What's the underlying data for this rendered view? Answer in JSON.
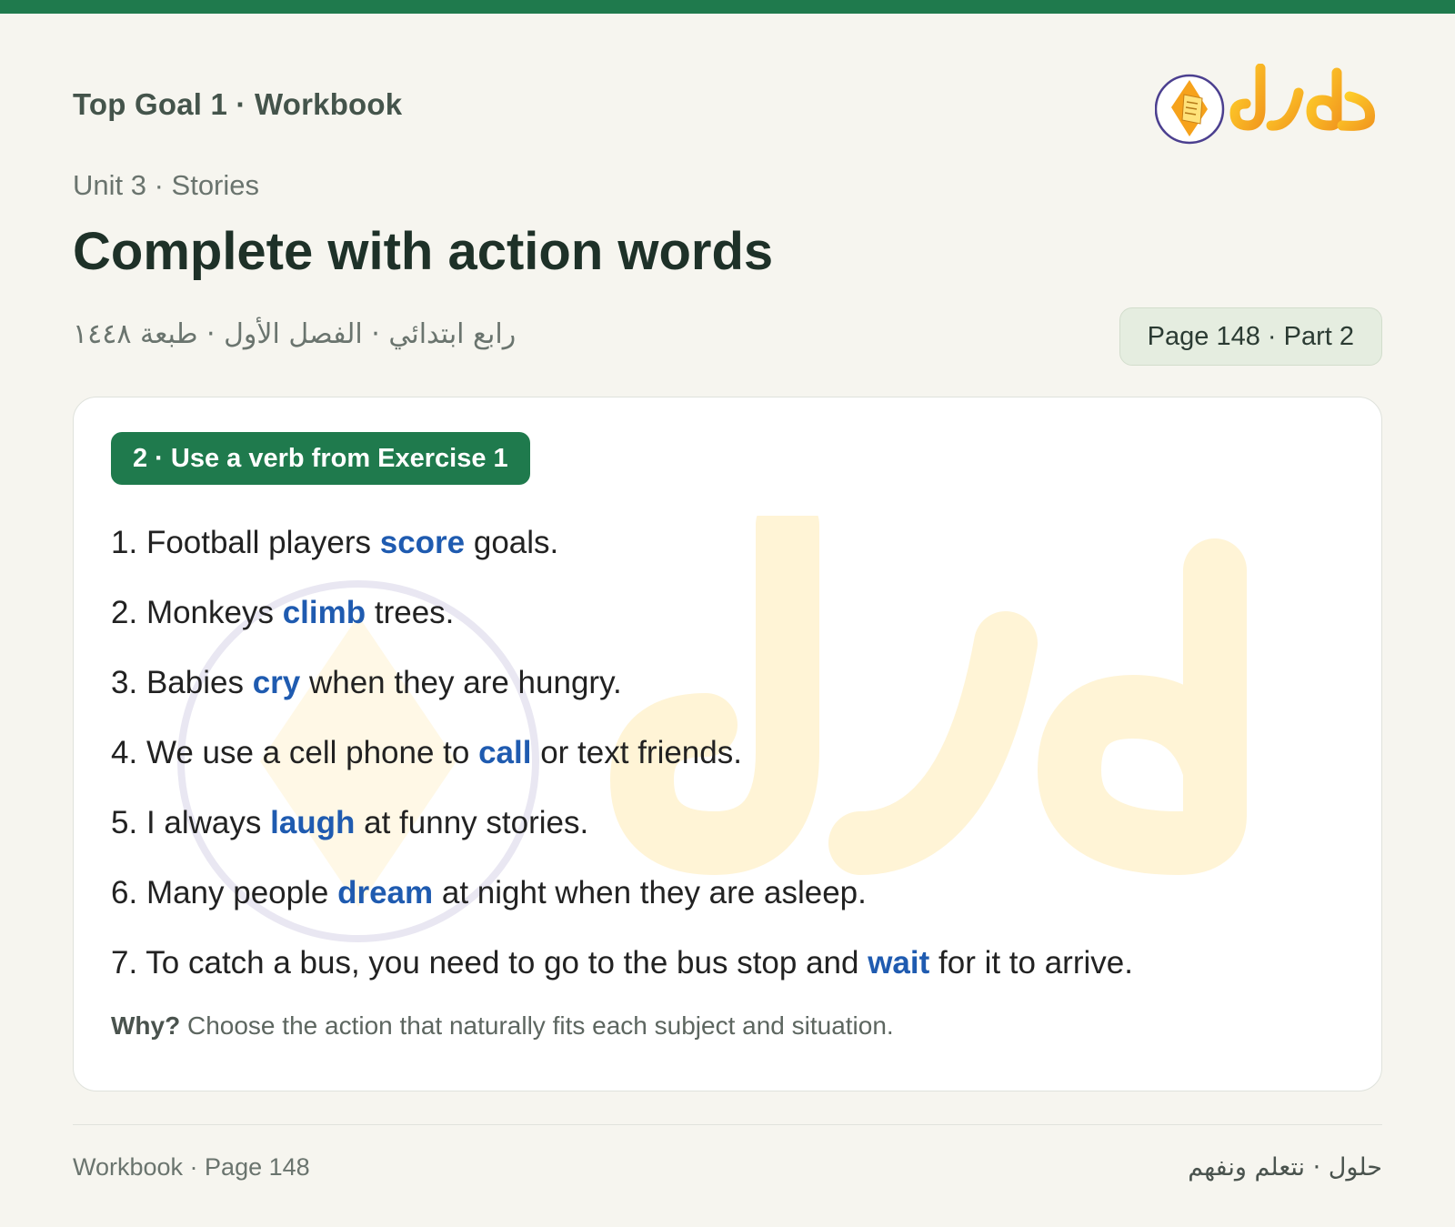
{
  "header": {
    "book_title": "Top Goal 1 · Workbook",
    "logo_text": "حلول"
  },
  "unit_label": "Unit 3 · Stories",
  "title": "Complete with action words",
  "arabic_meta": "رابع ابتدائي · الفصل الأول · طبعة ١٤٤٨",
  "page_badge": "Page 148 · Part 2",
  "exercise": {
    "badge": "2 · Use a verb from Exercise 1",
    "items": [
      {
        "num": "1.",
        "before": "Football players ",
        "answer": "score",
        "after": " goals."
      },
      {
        "num": "2.",
        "before": "Monkeys ",
        "answer": "climb",
        "after": " trees."
      },
      {
        "num": "3.",
        "before": "Babies ",
        "answer": "cry",
        "after": " when they are hungry."
      },
      {
        "num": "4.",
        "before": "We use a cell phone to ",
        "answer": "call",
        "after": " or text friends."
      },
      {
        "num": "5.",
        "before": "I always ",
        "answer": "laugh",
        "after": " at funny stories."
      },
      {
        "num": "6.",
        "before": "Many people ",
        "answer": "dream",
        "after": " at night when they are asleep."
      },
      {
        "num": "7.",
        "before": "To catch a bus, you need to go to the bus stop and ",
        "answer": "wait",
        "after": " for it to arrive."
      }
    ],
    "why_label": "Why?",
    "why_text": " Choose the action that naturally fits each subject and situation."
  },
  "footer": {
    "left": "Workbook · Page 148",
    "right": "حلول · نتعلم ونفهم"
  },
  "colors": {
    "accent_green": "#1f7a4d",
    "answer_blue": "#1f5bb0",
    "logo_orange": "#f29a1f",
    "logo_yellow": "#ffd12a"
  }
}
